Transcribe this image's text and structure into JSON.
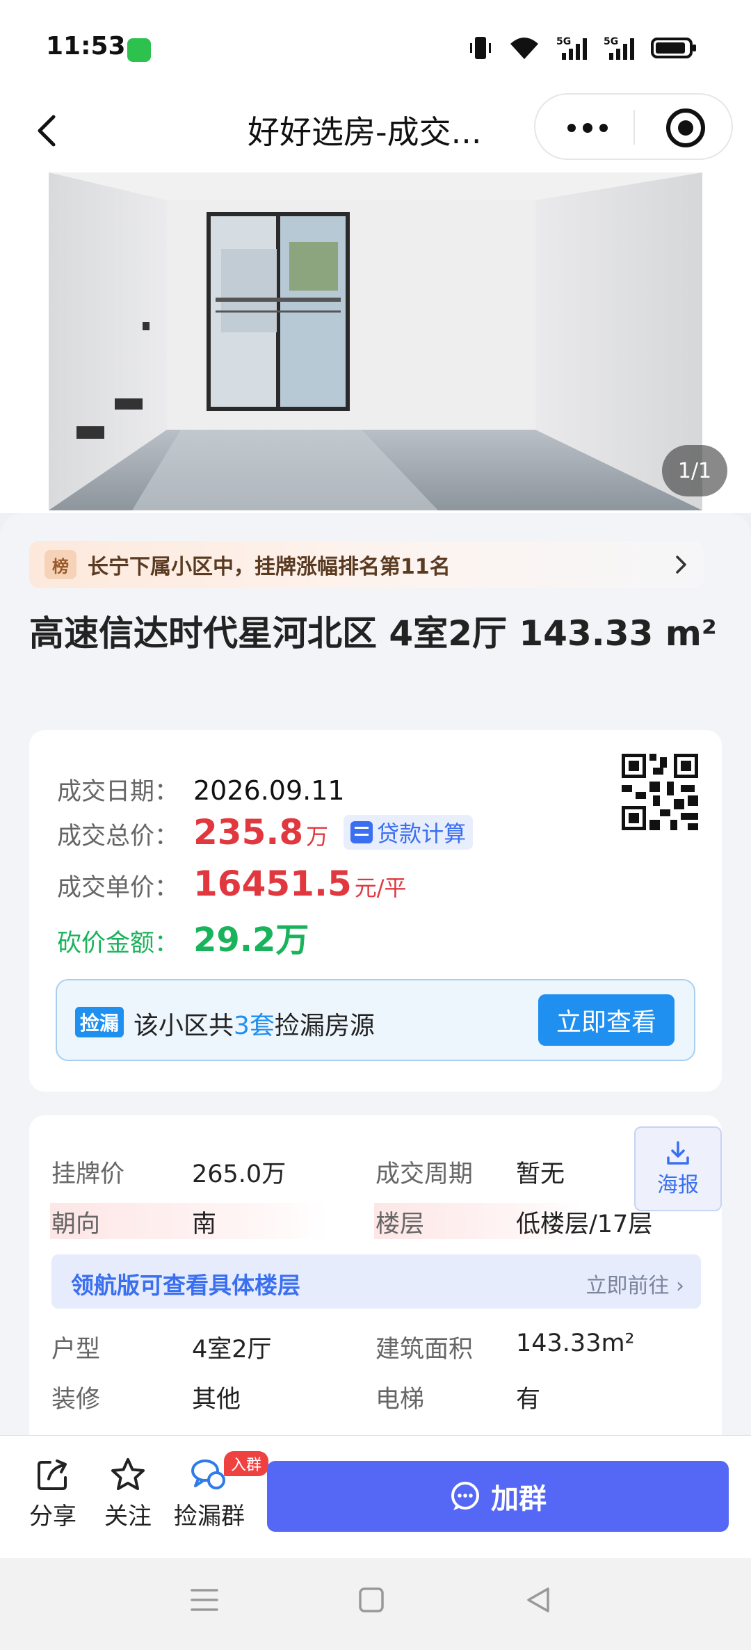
{
  "status": {
    "time": "11:53",
    "net1": "5G",
    "net2": "5G"
  },
  "header": {
    "title": "好好选房-成交..."
  },
  "photo": {
    "counter": "1/1"
  },
  "rank": {
    "tag": "榜",
    "text": "长宁下属小区中，挂牌涨幅排名第11名"
  },
  "house": {
    "title": "高速信达时代星河北区 4室2厅 143.33 m²"
  },
  "deal": {
    "date_label": "成交日期：",
    "date_value": "2026.09.11",
    "total_label": "成交总价：",
    "total_value": "235.8",
    "total_unit": "万",
    "loan_label": "贷款计算",
    "unit_label": "成交单价：",
    "unit_value": "16451.5",
    "unit_unit": "元/平",
    "cut_label": "砍价金额：",
    "cut_value": "29.2万"
  },
  "leak": {
    "tag": "捡漏",
    "text_before": "该小区共",
    "count": "3套",
    "text_after": "捡漏房源",
    "button": "立即查看"
  },
  "details": {
    "poster_label": "海报",
    "rows_top": [
      {
        "l1": "挂牌价",
        "v1": "265.0万",
        "l2": "成交周期",
        "v2": "暂无"
      },
      {
        "l1": "朝向",
        "v1": "南",
        "l2": "楼层",
        "v2": "低楼层/17层"
      }
    ],
    "pilot_text": "领航版可查看具体楼层",
    "pilot_link": "立即前往 ›",
    "rows_bottom": [
      {
        "l1": "户型",
        "v1": "4室2厅",
        "l2": "建筑面积",
        "v2": "143.33m²"
      },
      {
        "l1": "装修",
        "v1": "其他",
        "l2": "电梯",
        "v2": "有"
      }
    ]
  },
  "bottom": {
    "share": "分享",
    "follow": "关注",
    "group": "捡漏群",
    "badge": "入群",
    "join": "加群"
  },
  "colors": {
    "accent": "#5568f5",
    "price_red": "#e0383e",
    "green": "#19b35b",
    "blue": "#1f8ff0"
  }
}
